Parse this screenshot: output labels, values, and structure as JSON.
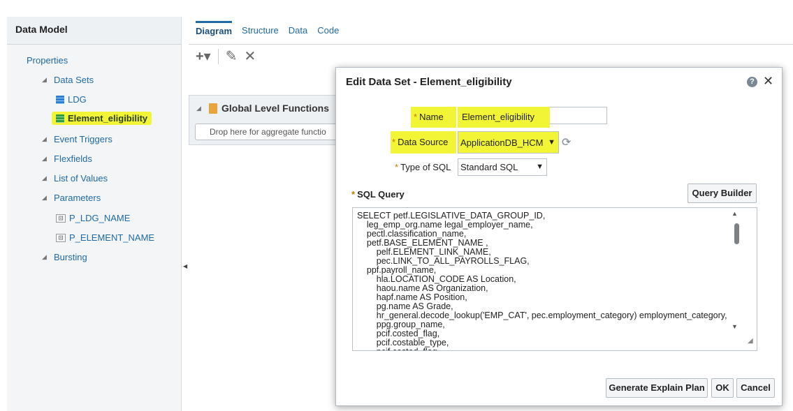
{
  "left_panel": {
    "title": "Data Model",
    "items": [
      {
        "label": "Properties"
      },
      {
        "label": "Data Sets"
      },
      {
        "label": "LDG"
      },
      {
        "label": "Element_eligibility"
      },
      {
        "label": "Event Triggers"
      },
      {
        "label": "Flexfields"
      },
      {
        "label": "List of Values"
      },
      {
        "label": "Parameters"
      },
      {
        "label": "P_LDG_NAME"
      },
      {
        "label": "P_ELEMENT_NAME"
      },
      {
        "label": "Bursting"
      }
    ]
  },
  "tabs": [
    {
      "label": "Diagram"
    },
    {
      "label": "Structure"
    },
    {
      "label": "Data"
    },
    {
      "label": "Code"
    }
  ],
  "toolbar": {
    "add": "+▾",
    "edit": "✎",
    "delete": "✕"
  },
  "global_panel": {
    "title": "Global Level Functions",
    "drop_text": "Drop here for aggregate functio"
  },
  "dialog": {
    "title": "Edit Data Set - Element_eligibility",
    "help": "?",
    "close": "✕",
    "name_label": "Name",
    "name_value": "Element_eligibility",
    "source_label": "Data Source",
    "source_value": "ApplicationDB_HCM",
    "sql_type_label": "Type of SQL",
    "sql_type_value": "Standard SQL",
    "required_mark": "*",
    "sql_query_label": "SQL Query",
    "query_builder": "Query Builder",
    "sql_text": "SELECT petf.LEGISLATIVE_DATA_GROUP_ID,\n    leg_emp_org.name legal_employer_name,\n    pectl.classification_name,\n    petf.BASE_ELEMENT_NAME ,\n        pelf.ELEMENT_LINK_NAME,\n        pec.LINK_TO_ALL_PAYROLLS_FLAG,\n    ppf.payroll_name,\n        hla.LOCATION_CODE AS Location,\n        haou.name AS Organization,\n        hapf.name AS Position,\n        pg.name AS Grade,\n        hr_general.decode_lookup('EMP_CAT', pec.employment_category) employment_category,\n        ppg.group_name,\n        pcif.costed_flag,\n        pcif.costable_type,\n        pcif.costed_flag,",
    "generate_plan": "Generate Explain Plan",
    "ok": "OK",
    "cancel": "Cancel"
  }
}
